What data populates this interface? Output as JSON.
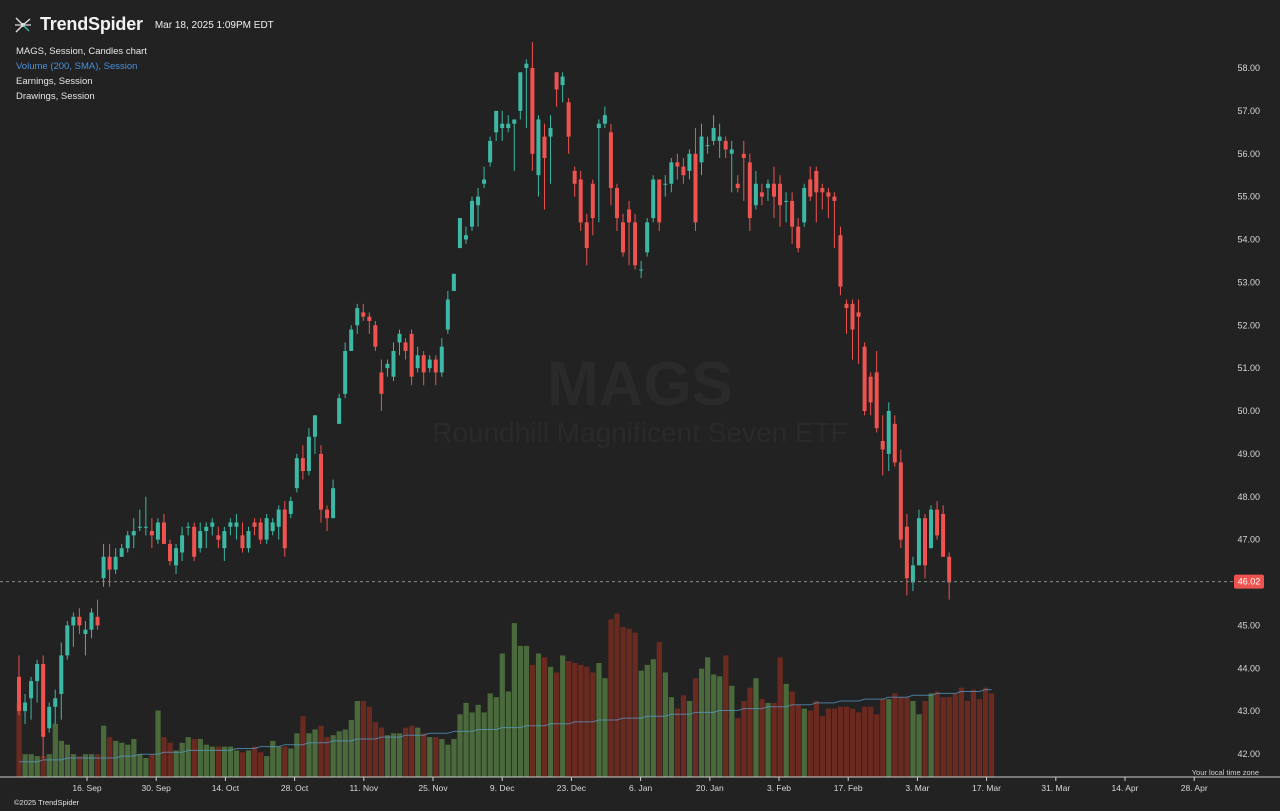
{
  "header": {
    "brand": "TrendSpider",
    "timestamp": "Mar 18, 2025 1:09PM EDT"
  },
  "legend": {
    "main": "MAGS, Session, Candles chart",
    "volume": "Volume (200, SMA), Session",
    "earnings": "Earnings, Session",
    "drawings": "Drawings, Session"
  },
  "watermark": {
    "symbol": "MAGS",
    "name": "Roundhill Magnificent Seven ETF"
  },
  "footer": {
    "copyright": "©2025 TrendSpider",
    "timezone_note": "Your local time zone"
  },
  "colors": {
    "background": "#222222",
    "up": "#3cb8a4",
    "down": "#ef5350",
    "volume_up": "#4a6a3c",
    "volume_down": "#6b2a20",
    "sma": "#5aa0d0",
    "price_tag": "#ef5350"
  },
  "chart_data": {
    "type": "candlestick",
    "symbol": "MAGS",
    "interval": "1D",
    "ylim": [
      41.7,
      58.6
    ],
    "y_ticks": [
      "58.00",
      "57.00",
      "56.00",
      "55.00",
      "54.00",
      "53.00",
      "52.00",
      "51.00",
      "50.00",
      "49.00",
      "48.00",
      "47.00",
      "46.00",
      "45.00",
      "44.00",
      "43.00",
      "42.00"
    ],
    "x_ticks": [
      "16. Sep",
      "30. Sep",
      "14. Oct",
      "28. Oct",
      "11. Nov",
      "25. Nov",
      "9. Dec",
      "23. Dec",
      "6. Jan",
      "20. Jan",
      "3. Feb",
      "17. Feb",
      "3. Mar",
      "17. Mar",
      "31. Mar",
      "14. Apr",
      "28. Apr"
    ],
    "last_price": "46.02",
    "volume_axis_ylim": [
      0,
      10
    ],
    "candles": [
      {
        "o": 43.8,
        "h": 44.3,
        "l": 42.9,
        "c": 43.0
      },
      {
        "o": 43.0,
        "h": 43.4,
        "l": 42.7,
        "c": 43.2
      },
      {
        "o": 43.3,
        "h": 43.8,
        "l": 42.8,
        "c": 43.7
      },
      {
        "o": 43.7,
        "h": 44.2,
        "l": 43.2,
        "c": 44.1
      },
      {
        "o": 44.1,
        "h": 44.3,
        "l": 41.9,
        "c": 42.4
      },
      {
        "o": 42.6,
        "h": 43.2,
        "l": 42.5,
        "c": 43.1
      },
      {
        "o": 43.1,
        "h": 43.5,
        "l": 42.7,
        "c": 43.3
      },
      {
        "o": 43.4,
        "h": 44.6,
        "l": 42.8,
        "c": 44.3
      },
      {
        "o": 44.3,
        "h": 45.1,
        "l": 44.2,
        "c": 45.0
      },
      {
        "o": 45.0,
        "h": 45.3,
        "l": 44.5,
        "c": 45.2
      },
      {
        "o": 45.2,
        "h": 45.4,
        "l": 44.8,
        "c": 45.0
      },
      {
        "o": 44.8,
        "h": 45.1,
        "l": 44.3,
        "c": 44.9
      },
      {
        "o": 44.9,
        "h": 45.4,
        "l": 44.7,
        "c": 45.3
      },
      {
        "o": 45.2,
        "h": 45.6,
        "l": 44.9,
        "c": 45.0
      },
      {
        "o": 46.1,
        "h": 46.9,
        "l": 45.9,
        "c": 46.6
      },
      {
        "o": 46.6,
        "h": 46.9,
        "l": 45.9,
        "c": 46.3
      },
      {
        "o": 46.3,
        "h": 46.8,
        "l": 46.2,
        "c": 46.6
      },
      {
        "o": 46.6,
        "h": 46.9,
        "l": 46.6,
        "c": 46.8
      },
      {
        "o": 46.8,
        "h": 47.2,
        "l": 46.7,
        "c": 47.1
      },
      {
        "o": 47.1,
        "h": 47.5,
        "l": 46.8,
        "c": 47.2
      },
      {
        "o": 47.3,
        "h": 47.7,
        "l": 47.2,
        "c": 47.3
      },
      {
        "o": 47.3,
        "h": 48.0,
        "l": 47.1,
        "c": 47.3
      },
      {
        "o": 47.2,
        "h": 47.5,
        "l": 46.8,
        "c": 47.1
      },
      {
        "o": 47.0,
        "h": 47.5,
        "l": 46.9,
        "c": 47.4
      },
      {
        "o": 47.4,
        "h": 47.6,
        "l": 46.9,
        "c": 46.9
      },
      {
        "o": 46.9,
        "h": 47.0,
        "l": 46.4,
        "c": 46.5
      },
      {
        "o": 46.4,
        "h": 46.9,
        "l": 46.2,
        "c": 46.8
      },
      {
        "o": 46.7,
        "h": 47.3,
        "l": 46.5,
        "c": 47.1
      },
      {
        "o": 47.3,
        "h": 47.4,
        "l": 47.1,
        "c": 47.3
      },
      {
        "o": 47.3,
        "h": 47.4,
        "l": 46.5,
        "c": 46.6
      },
      {
        "o": 46.8,
        "h": 47.4,
        "l": 46.7,
        "c": 47.2
      },
      {
        "o": 47.2,
        "h": 47.4,
        "l": 46.8,
        "c": 47.3
      },
      {
        "o": 47.3,
        "h": 47.5,
        "l": 47.1,
        "c": 47.4
      },
      {
        "o": 47.1,
        "h": 47.3,
        "l": 46.8,
        "c": 47.0
      },
      {
        "o": 46.8,
        "h": 47.3,
        "l": 46.5,
        "c": 47.2
      },
      {
        "o": 47.3,
        "h": 47.5,
        "l": 47.1,
        "c": 47.4
      },
      {
        "o": 47.3,
        "h": 47.6,
        "l": 47.0,
        "c": 47.4
      },
      {
        "o": 47.1,
        "h": 47.4,
        "l": 46.7,
        "c": 46.8
      },
      {
        "o": 46.8,
        "h": 47.3,
        "l": 46.7,
        "c": 47.2
      },
      {
        "o": 47.4,
        "h": 47.5,
        "l": 47.1,
        "c": 47.3
      },
      {
        "o": 47.4,
        "h": 47.5,
        "l": 46.9,
        "c": 47.0
      },
      {
        "o": 47.0,
        "h": 47.6,
        "l": 46.9,
        "c": 47.5
      },
      {
        "o": 47.2,
        "h": 47.5,
        "l": 47.1,
        "c": 47.4
      },
      {
        "o": 47.3,
        "h": 47.8,
        "l": 47.0,
        "c": 47.7
      },
      {
        "o": 47.7,
        "h": 47.9,
        "l": 46.6,
        "c": 46.8
      },
      {
        "o": 47.6,
        "h": 48.0,
        "l": 47.5,
        "c": 47.9
      },
      {
        "o": 48.2,
        "h": 49.0,
        "l": 48.1,
        "c": 48.9
      },
      {
        "o": 48.9,
        "h": 49.2,
        "l": 48.4,
        "c": 48.6
      },
      {
        "o": 48.6,
        "h": 49.6,
        "l": 48.5,
        "c": 49.4
      },
      {
        "o": 49.4,
        "h": 49.9,
        "l": 49.0,
        "c": 49.9
      },
      {
        "o": 49.0,
        "h": 49.2,
        "l": 47.4,
        "c": 47.7
      },
      {
        "o": 47.7,
        "h": 47.8,
        "l": 47.2,
        "c": 47.5
      },
      {
        "o": 47.5,
        "h": 48.4,
        "l": 47.5,
        "c": 48.2
      },
      {
        "o": 49.7,
        "h": 50.4,
        "l": 49.7,
        "c": 50.3
      },
      {
        "o": 50.4,
        "h": 51.6,
        "l": 50.3,
        "c": 51.4
      },
      {
        "o": 51.4,
        "h": 52.0,
        "l": 51.4,
        "c": 51.9
      },
      {
        "o": 52.0,
        "h": 52.5,
        "l": 51.8,
        "c": 52.4
      },
      {
        "o": 52.3,
        "h": 52.5,
        "l": 52.1,
        "c": 52.2
      },
      {
        "o": 52.2,
        "h": 52.3,
        "l": 51.8,
        "c": 52.1
      },
      {
        "o": 52.0,
        "h": 52.1,
        "l": 51.4,
        "c": 51.5
      },
      {
        "o": 50.9,
        "h": 51.2,
        "l": 50.0,
        "c": 50.4
      },
      {
        "o": 51.0,
        "h": 51.2,
        "l": 50.8,
        "c": 51.1
      },
      {
        "o": 50.8,
        "h": 51.6,
        "l": 50.7,
        "c": 51.4
      },
      {
        "o": 51.6,
        "h": 51.9,
        "l": 51.3,
        "c": 51.8
      },
      {
        "o": 51.6,
        "h": 51.7,
        "l": 51.2,
        "c": 51.4
      },
      {
        "o": 51.8,
        "h": 51.9,
        "l": 50.6,
        "c": 50.8
      },
      {
        "o": 51.0,
        "h": 51.5,
        "l": 50.9,
        "c": 51.3
      },
      {
        "o": 51.3,
        "h": 51.4,
        "l": 50.6,
        "c": 50.9
      },
      {
        "o": 51.0,
        "h": 51.3,
        "l": 50.9,
        "c": 51.2
      },
      {
        "o": 51.2,
        "h": 51.3,
        "l": 50.6,
        "c": 50.9
      },
      {
        "o": 50.9,
        "h": 51.7,
        "l": 50.8,
        "c": 51.5
      },
      {
        "o": 51.9,
        "h": 52.8,
        "l": 51.8,
        "c": 52.6
      },
      {
        "o": 52.8,
        "h": 53.2,
        "l": 52.8,
        "c": 53.2
      },
      {
        "o": 53.8,
        "h": 54.5,
        "l": 53.8,
        "c": 54.5
      },
      {
        "o": 54.0,
        "h": 54.3,
        "l": 53.9,
        "c": 54.1
      },
      {
        "o": 54.3,
        "h": 55.0,
        "l": 54.2,
        "c": 54.9
      },
      {
        "o": 54.8,
        "h": 55.2,
        "l": 54.3,
        "c": 55.0
      },
      {
        "o": 55.3,
        "h": 55.7,
        "l": 55.2,
        "c": 55.4
      },
      {
        "o": 55.8,
        "h": 56.4,
        "l": 55.7,
        "c": 56.3
      },
      {
        "o": 56.5,
        "h": 57.0,
        "l": 56.3,
        "c": 57.0
      },
      {
        "o": 56.6,
        "h": 57.0,
        "l": 56.3,
        "c": 56.7
      },
      {
        "o": 56.6,
        "h": 56.9,
        "l": 56.5,
        "c": 56.7
      },
      {
        "o": 56.7,
        "h": 56.8,
        "l": 55.6,
        "c": 56.8
      },
      {
        "o": 57.0,
        "h": 57.9,
        "l": 56.8,
        "c": 57.9
      },
      {
        "o": 58.0,
        "h": 58.2,
        "l": 56.6,
        "c": 58.1
      },
      {
        "o": 58.0,
        "h": 58.6,
        "l": 55.6,
        "c": 56.0
      },
      {
        "o": 55.5,
        "h": 56.9,
        "l": 55.0,
        "c": 56.8
      },
      {
        "o": 56.4,
        "h": 56.7,
        "l": 54.7,
        "c": 55.9
      },
      {
        "o": 56.4,
        "h": 56.9,
        "l": 55.3,
        "c": 56.6
      },
      {
        "o": 57.9,
        "h": 57.9,
        "l": 57.1,
        "c": 57.5
      },
      {
        "o": 57.6,
        "h": 57.9,
        "l": 57.2,
        "c": 57.8
      },
      {
        "o": 57.2,
        "h": 57.3,
        "l": 56.0,
        "c": 56.4
      },
      {
        "o": 55.6,
        "h": 55.7,
        "l": 55.0,
        "c": 55.3
      },
      {
        "o": 55.4,
        "h": 55.6,
        "l": 54.2,
        "c": 54.4
      },
      {
        "o": 54.4,
        "h": 54.6,
        "l": 53.4,
        "c": 53.8
      },
      {
        "o": 55.3,
        "h": 55.4,
        "l": 54.1,
        "c": 54.5
      },
      {
        "o": 56.6,
        "h": 56.8,
        "l": 54.4,
        "c": 56.7
      },
      {
        "o": 56.7,
        "h": 57.1,
        "l": 56.6,
        "c": 56.9
      },
      {
        "o": 56.5,
        "h": 56.7,
        "l": 54.8,
        "c": 55.2
      },
      {
        "o": 55.2,
        "h": 55.3,
        "l": 54.2,
        "c": 54.5
      },
      {
        "o": 54.4,
        "h": 54.6,
        "l": 53.6,
        "c": 53.7
      },
      {
        "o": 54.7,
        "h": 54.9,
        "l": 53.4,
        "c": 54.4
      },
      {
        "o": 54.4,
        "h": 54.6,
        "l": 53.3,
        "c": 53.4
      },
      {
        "o": 53.3,
        "h": 53.5,
        "l": 53.1,
        "c": 53.3
      },
      {
        "o": 53.7,
        "h": 54.5,
        "l": 53.6,
        "c": 54.4
      },
      {
        "o": 54.5,
        "h": 55.5,
        "l": 54.4,
        "c": 55.4
      },
      {
        "o": 55.4,
        "h": 55.4,
        "l": 54.2,
        "c": 54.4
      },
      {
        "o": 55.3,
        "h": 55.5,
        "l": 55.0,
        "c": 55.3
      },
      {
        "o": 55.3,
        "h": 55.9,
        "l": 55.1,
        "c": 55.8
      },
      {
        "o": 55.8,
        "h": 56.0,
        "l": 55.4,
        "c": 55.7
      },
      {
        "o": 55.7,
        "h": 55.9,
        "l": 55.3,
        "c": 55.5
      },
      {
        "o": 55.6,
        "h": 56.1,
        "l": 55.4,
        "c": 56.0
      },
      {
        "o": 56.0,
        "h": 56.6,
        "l": 54.2,
        "c": 54.4
      },
      {
        "o": 55.8,
        "h": 56.7,
        "l": 55.5,
        "c": 56.4
      },
      {
        "o": 56.2,
        "h": 56.4,
        "l": 56.0,
        "c": 56.2
      },
      {
        "o": 56.3,
        "h": 56.9,
        "l": 56.2,
        "c": 56.6
      },
      {
        "o": 56.3,
        "h": 56.7,
        "l": 55.9,
        "c": 56.4
      },
      {
        "o": 56.3,
        "h": 56.4,
        "l": 55.9,
        "c": 56.1
      },
      {
        "o": 56.0,
        "h": 56.3,
        "l": 55.1,
        "c": 56.1
      },
      {
        "o": 55.3,
        "h": 55.5,
        "l": 55.1,
        "c": 55.2
      },
      {
        "o": 56.0,
        "h": 56.3,
        "l": 54.9,
        "c": 55.9
      },
      {
        "o": 55.8,
        "h": 56.0,
        "l": 54.2,
        "c": 54.5
      },
      {
        "o": 54.8,
        "h": 55.6,
        "l": 54.7,
        "c": 55.3
      },
      {
        "o": 55.1,
        "h": 55.3,
        "l": 54.8,
        "c": 55.0
      },
      {
        "o": 55.2,
        "h": 55.4,
        "l": 54.9,
        "c": 55.3
      },
      {
        "o": 55.3,
        "h": 55.7,
        "l": 54.5,
        "c": 55.0
      },
      {
        "o": 55.3,
        "h": 55.5,
        "l": 54.3,
        "c": 54.8
      },
      {
        "o": 54.9,
        "h": 55.1,
        "l": 54.4,
        "c": 54.9
      },
      {
        "o": 54.9,
        "h": 55.1,
        "l": 53.9,
        "c": 54.3
      },
      {
        "o": 54.3,
        "h": 54.5,
        "l": 53.7,
        "c": 53.8
      },
      {
        "o": 54.4,
        "h": 55.3,
        "l": 54.3,
        "c": 55.2
      },
      {
        "o": 55.4,
        "h": 55.7,
        "l": 54.9,
        "c": 55.0
      },
      {
        "o": 55.6,
        "h": 55.7,
        "l": 54.4,
        "c": 55.1
      },
      {
        "o": 55.2,
        "h": 55.3,
        "l": 54.7,
        "c": 55.1
      },
      {
        "o": 55.1,
        "h": 55.2,
        "l": 54.5,
        "c": 55.0
      },
      {
        "o": 55.0,
        "h": 55.1,
        "l": 53.8,
        "c": 54.9
      },
      {
        "o": 54.1,
        "h": 54.3,
        "l": 52.7,
        "c": 52.9
      },
      {
        "o": 52.5,
        "h": 52.6,
        "l": 51.8,
        "c": 52.4
      },
      {
        "o": 52.5,
        "h": 52.6,
        "l": 51.2,
        "c": 51.9
      },
      {
        "o": 52.3,
        "h": 52.6,
        "l": 51.1,
        "c": 52.2
      },
      {
        "o": 51.5,
        "h": 51.6,
        "l": 49.9,
        "c": 50.0
      },
      {
        "o": 50.8,
        "h": 50.9,
        "l": 49.9,
        "c": 50.2
      },
      {
        "o": 50.9,
        "h": 51.4,
        "l": 49.5,
        "c": 49.6
      },
      {
        "o": 49.3,
        "h": 49.9,
        "l": 48.5,
        "c": 49.1
      },
      {
        "o": 49.0,
        "h": 50.2,
        "l": 48.6,
        "c": 50.0
      },
      {
        "o": 49.7,
        "h": 49.9,
        "l": 48.7,
        "c": 48.8
      },
      {
        "o": 48.8,
        "h": 49.1,
        "l": 46.8,
        "c": 47.0
      },
      {
        "o": 47.3,
        "h": 47.6,
        "l": 45.7,
        "c": 46.1
      },
      {
        "o": 46.0,
        "h": 46.6,
        "l": 45.8,
        "c": 46.4
      },
      {
        "o": 46.4,
        "h": 47.7,
        "l": 46.4,
        "c": 47.5
      },
      {
        "o": 47.5,
        "h": 47.6,
        "l": 46.1,
        "c": 46.4
      },
      {
        "o": 46.8,
        "h": 47.8,
        "l": 46.8,
        "c": 47.7
      },
      {
        "o": 47.7,
        "h": 47.9,
        "l": 47.0,
        "c": 47.1
      },
      {
        "o": 47.6,
        "h": 47.8,
        "l": 46.6,
        "c": 46.6
      },
      {
        "o": 46.6,
        "h": 46.7,
        "l": 45.6,
        "c": 46.0
      }
    ],
    "volume": [
      3.9,
      1.2,
      1.2,
      1.1,
      1.1,
      1.2,
      2.8,
      1.9,
      1.7,
      1.2,
      1.1,
      1.2,
      1.2,
      1.2,
      2.7,
      2.1,
      1.9,
      1.8,
      1.7,
      2.0,
      1.2,
      1.0,
      1.2,
      3.5,
      2.1,
      1.8,
      1.4,
      1.8,
      2.1,
      2.0,
      2.0,
      1.7,
      1.6,
      1.6,
      1.6,
      1.6,
      1.4,
      1.3,
      1.4,
      1.6,
      1.3,
      1.1,
      1.9,
      1.6,
      1.6,
      1.5,
      2.3,
      3.2,
      2.3,
      2.5,
      2.7,
      2.1,
      2.2,
      2.4,
      2.5,
      3.0,
      4.0,
      4.0,
      3.7,
      2.9,
      2.6,
      2.2,
      2.3,
      2.3,
      2.6,
      2.7,
      2.6,
      2.3,
      2.1,
      2.1,
      2.0,
      1.7,
      2.0,
      3.3,
      3.9,
      3.4,
      3.8,
      3.4,
      4.4,
      4.2,
      6.5,
      4.5,
      8.1,
      6.9,
      6.9,
      5.9,
      6.5,
      6.3,
      5.8,
      5.5,
      6.4,
      6.1,
      6.0,
      5.9,
      5.8,
      5.5,
      6.0,
      5.2,
      8.3,
      8.6,
      7.9,
      7.8,
      7.6,
      5.6,
      5.9,
      6.2,
      7.1,
      5.5,
      4.2,
      3.6,
      4.3,
      4.0,
      5.2,
      5.7,
      6.3,
      5.4,
      5.3,
      6.4,
      4.8,
      3.1,
      4.0,
      4.7,
      5.2,
      4.1,
      3.9,
      3.9,
      6.3,
      4.9,
      4.5,
      3.8,
      3.6,
      3.5,
      4.0,
      3.2,
      3.6,
      3.6,
      3.7,
      3.7,
      3.6,
      3.4,
      3.7,
      3.7,
      3.3,
      4.1,
      4.1,
      4.4,
      4.2,
      4.2,
      4.0,
      3.3,
      4.0,
      4.4,
      4.5,
      4.2,
      4.2,
      4.4,
      4.7,
      4.0,
      4.6,
      4.1,
      4.7,
      4.4
    ],
    "sma": [
      0.8,
      0.8,
      0.8,
      0.8,
      0.9,
      0.9,
      0.9,
      0.9,
      1.0,
      1.0,
      1.0,
      1.0,
      1.0,
      1.0,
      1.0,
      1.0,
      1.0,
      1.1,
      1.1,
      1.1,
      1.2,
      1.2,
      1.2,
      1.2,
      1.3,
      1.3,
      1.3,
      1.3,
      1.4,
      1.4,
      1.4,
      1.4,
      1.4,
      1.4,
      1.4,
      1.4,
      1.5,
      1.5,
      1.5,
      1.5,
      1.6,
      1.6,
      1.6,
      1.6,
      1.7,
      1.7,
      1.7,
      1.7,
      1.8,
      1.8,
      1.8,
      1.8,
      1.9,
      1.9,
      1.9,
      1.9,
      2.0,
      2.0,
      2.0,
      2.0,
      2.1,
      2.1,
      2.1,
      2.1,
      2.2,
      2.2,
      2.2,
      2.2,
      2.3,
      2.3,
      2.3,
      2.3,
      2.4,
      2.4,
      2.4,
      2.4,
      2.5,
      2.5,
      2.5,
      2.5,
      2.6,
      2.6,
      2.6,
      2.6,
      2.7,
      2.7,
      2.7,
      2.7,
      2.8,
      2.8,
      2.8,
      2.8,
      2.9,
      2.9,
      2.9,
      2.9,
      3.0,
      3.0,
      3.0,
      3.0,
      3.1,
      3.1,
      3.1,
      3.1,
      3.2,
      3.2,
      3.2,
      3.2,
      3.3,
      3.3,
      3.3,
      3.3,
      3.4,
      3.4,
      3.4,
      3.4,
      3.5,
      3.5,
      3.5,
      3.5,
      3.6,
      3.6,
      3.6,
      3.6,
      3.7,
      3.7,
      3.7,
      3.7,
      3.8,
      3.8,
      3.8,
      3.8,
      3.9,
      3.9,
      3.9,
      3.9,
      4.0,
      4.0,
      4.0,
      4.0,
      4.1,
      4.1,
      4.1,
      4.1,
      4.2,
      4.2,
      4.2,
      4.2,
      4.3,
      4.3,
      4.3,
      4.3,
      4.4,
      4.4,
      4.4,
      4.4,
      4.5,
      4.5,
      4.5,
      4.5,
      4.6,
      4.6
    ]
  }
}
